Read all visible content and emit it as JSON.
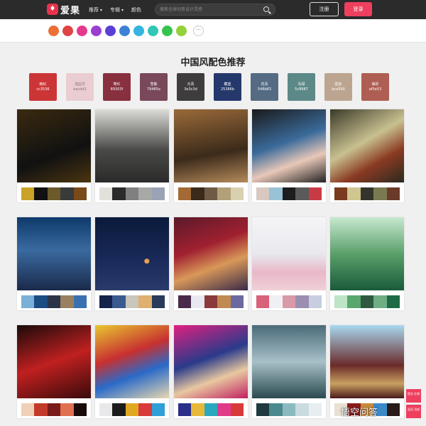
{
  "nav": {
    "logo_mark": "♦",
    "logo_text": "爱果",
    "items": [
      {
        "label": "推荐"
      },
      {
        "label": "专辑"
      },
      {
        "label": "颜色"
      }
    ],
    "search_placeholder": "搜索全球创意设计灵感",
    "register": "注册",
    "login": "登录"
  },
  "colors": [
    "#ec6f35",
    "#e04343",
    "#e6388d",
    "#9b3fd1",
    "#5a3fd6",
    "#3b82d6",
    "#33b5e0",
    "#30c7b5",
    "#36c44f",
    "#94d13a"
  ],
  "more": "···",
  "title": "中国风配色推荐",
  "swatches": [
    {
      "name": "韩红",
      "code": "cc3536",
      "color": "#cc3536",
      "light": false
    },
    {
      "name": "浅血牙",
      "code": "eacdd1",
      "color": "#eacdd1",
      "light": true
    },
    {
      "name": "枣红",
      "code": "89303f",
      "color": "#89303f",
      "light": false
    },
    {
      "name": "雪紫",
      "code": "79485a",
      "color": "#79485a",
      "light": false
    },
    {
      "name": "元青",
      "code": "3e3c3d",
      "color": "#3e3c3d",
      "light": false
    },
    {
      "name": "藏蓝",
      "code": "25386b",
      "color": "#25386b",
      "light": false
    },
    {
      "name": "花青",
      "code": "546b83",
      "color": "#546b83",
      "light": false
    },
    {
      "name": "东绿",
      "code": "5c8987",
      "color": "#5c8987",
      "light": false
    },
    {
      "name": "驼色",
      "code": "bca590",
      "color": "#bca590",
      "light": false
    },
    {
      "name": "苺砂",
      "code": "af5e53",
      "color": "#af5e53",
      "light": false
    }
  ],
  "cards": [
    {
      "bg": "linear-gradient(160deg,#3a2a10,#111 60%,#4a3510)",
      "palette": [
        "#c9a227",
        "#111111",
        "#6b5a2a",
        "#3a3a3a",
        "#7a4a1a"
      ]
    },
    {
      "bg": "linear-gradient(180deg,#dcdcd8,#4a4a48 55%,#2a2a2a)",
      "palette": [
        "#e2e0da",
        "#2b2b2b",
        "#808080",
        "#a7a9a6",
        "#9aa3b5"
      ]
    },
    {
      "bg": "linear-gradient(170deg,#9a6a3a,#3b2a1a 60%,#b48a5a)",
      "palette": [
        "#a36a35",
        "#3a2a1a",
        "#6e5a45",
        "#b1a078",
        "#d8d0b0"
      ]
    },
    {
      "bg": "linear-gradient(160deg,#1a1a1a,#3a6a9a 45%,#e8c8b8 70%,#222)",
      "palette": [
        "#d8c8c0",
        "#99c2d6",
        "#1d1d1d",
        "#5a5a5a",
        "#c93b44"
      ]
    },
    {
      "bg": "linear-gradient(150deg,#3a3a28,#c8c090 45%,#8a3a22 70%,#2a2a20)",
      "palette": [
        "#7a3a20",
        "#cfc690",
        "#33352d",
        "#7a7a50",
        "#6b3a28"
      ]
    },
    {
      "bg": "linear-gradient(180deg,#0e3a6a,#3a6aa0 45%,#1a2a4a)",
      "palette": [
        "#7ab0d8",
        "#1b4c82",
        "#2c3548",
        "#9a8060",
        "#3a70b0"
      ]
    },
    {
      "bg": "radial-gradient(circle at 70% 60%,#e8a050 0 3px,transparent 4px),linear-gradient(180deg,#0a1a3a,#1a2a5a 60%,#2a3a6a)",
      "palette": [
        "#13234a",
        "#3a5a90",
        "#c9c6bb",
        "#e0b070",
        "#2a3a5a"
      ]
    },
    {
      "bg": "linear-gradient(160deg,#5a1a2a,#a02030 40%,#d89858 65%,#3a2a4a)",
      "palette": [
        "#4a2a4a",
        "#e8e8f0",
        "#8a3a3a",
        "#c08a50",
        "#6b6aa0"
      ]
    },
    {
      "bg": "linear-gradient(180deg,#f5f5f7,#e8e8ee 50%,#e8b8c8 75%,#f0d0d8)",
      "palette": [
        "#d8627a",
        "#f0f0f4",
        "#d89aa8",
        "#9a8fb0",
        "#c8cde0"
      ]
    },
    {
      "bg": "linear-gradient(180deg,#c8e8d0,#5aa06a 50%,#1a5a3a)",
      "palette": [
        "#bde4c6",
        "#58a86e",
        "#2f5a40",
        "#6fae85",
        "#1e6a44"
      ]
    },
    {
      "bg": "linear-gradient(160deg,#1a0a0a,#c02020 50%,#3a0a0a)",
      "palette": [
        "#f0d0b8",
        "#c43a2a",
        "#7a1a1a",
        "#e07050",
        "#1a0a0a"
      ]
    },
    {
      "bg": "linear-gradient(160deg,#e8c830,#c83030 40%,#2a6ac8 65%,#e8d8b0)",
      "palette": [
        "#e8e8ea",
        "#1b1b1b",
        "#e0a820",
        "#d93a3a",
        "#2f9fd8"
      ]
    },
    {
      "bg": "linear-gradient(160deg,#e02080,#2a3a8a 45%,#e8c8a0 70%,#c02060)",
      "palette": [
        "#2a2f8a",
        "#e8b838",
        "#2aa8c0",
        "#e03a8a",
        "#d83a3a"
      ]
    },
    {
      "bg": "linear-gradient(180deg,#4a6a78,#a8c0c8 50%,#2a4a50)",
      "palette": [
        "#1f3a3e",
        "#4a8a8e",
        "#8abac0",
        "#c9dbe0",
        "#e8eef0"
      ]
    },
    {
      "bg": "linear-gradient(180deg,#a8d8f0,#6a2a2a 55%,#c8a060 80%,#4a1a1a)",
      "palette": [
        "#e8e0d0",
        "#8a1a1a",
        "#c88a3a",
        "#3a8ac8",
        "#2a1a1a"
      ]
    }
  ],
  "float_items": [
    {
      "label": "提交 反馈"
    },
    {
      "label": "返回 顶部"
    }
  ],
  "watermark": "悟空问答"
}
